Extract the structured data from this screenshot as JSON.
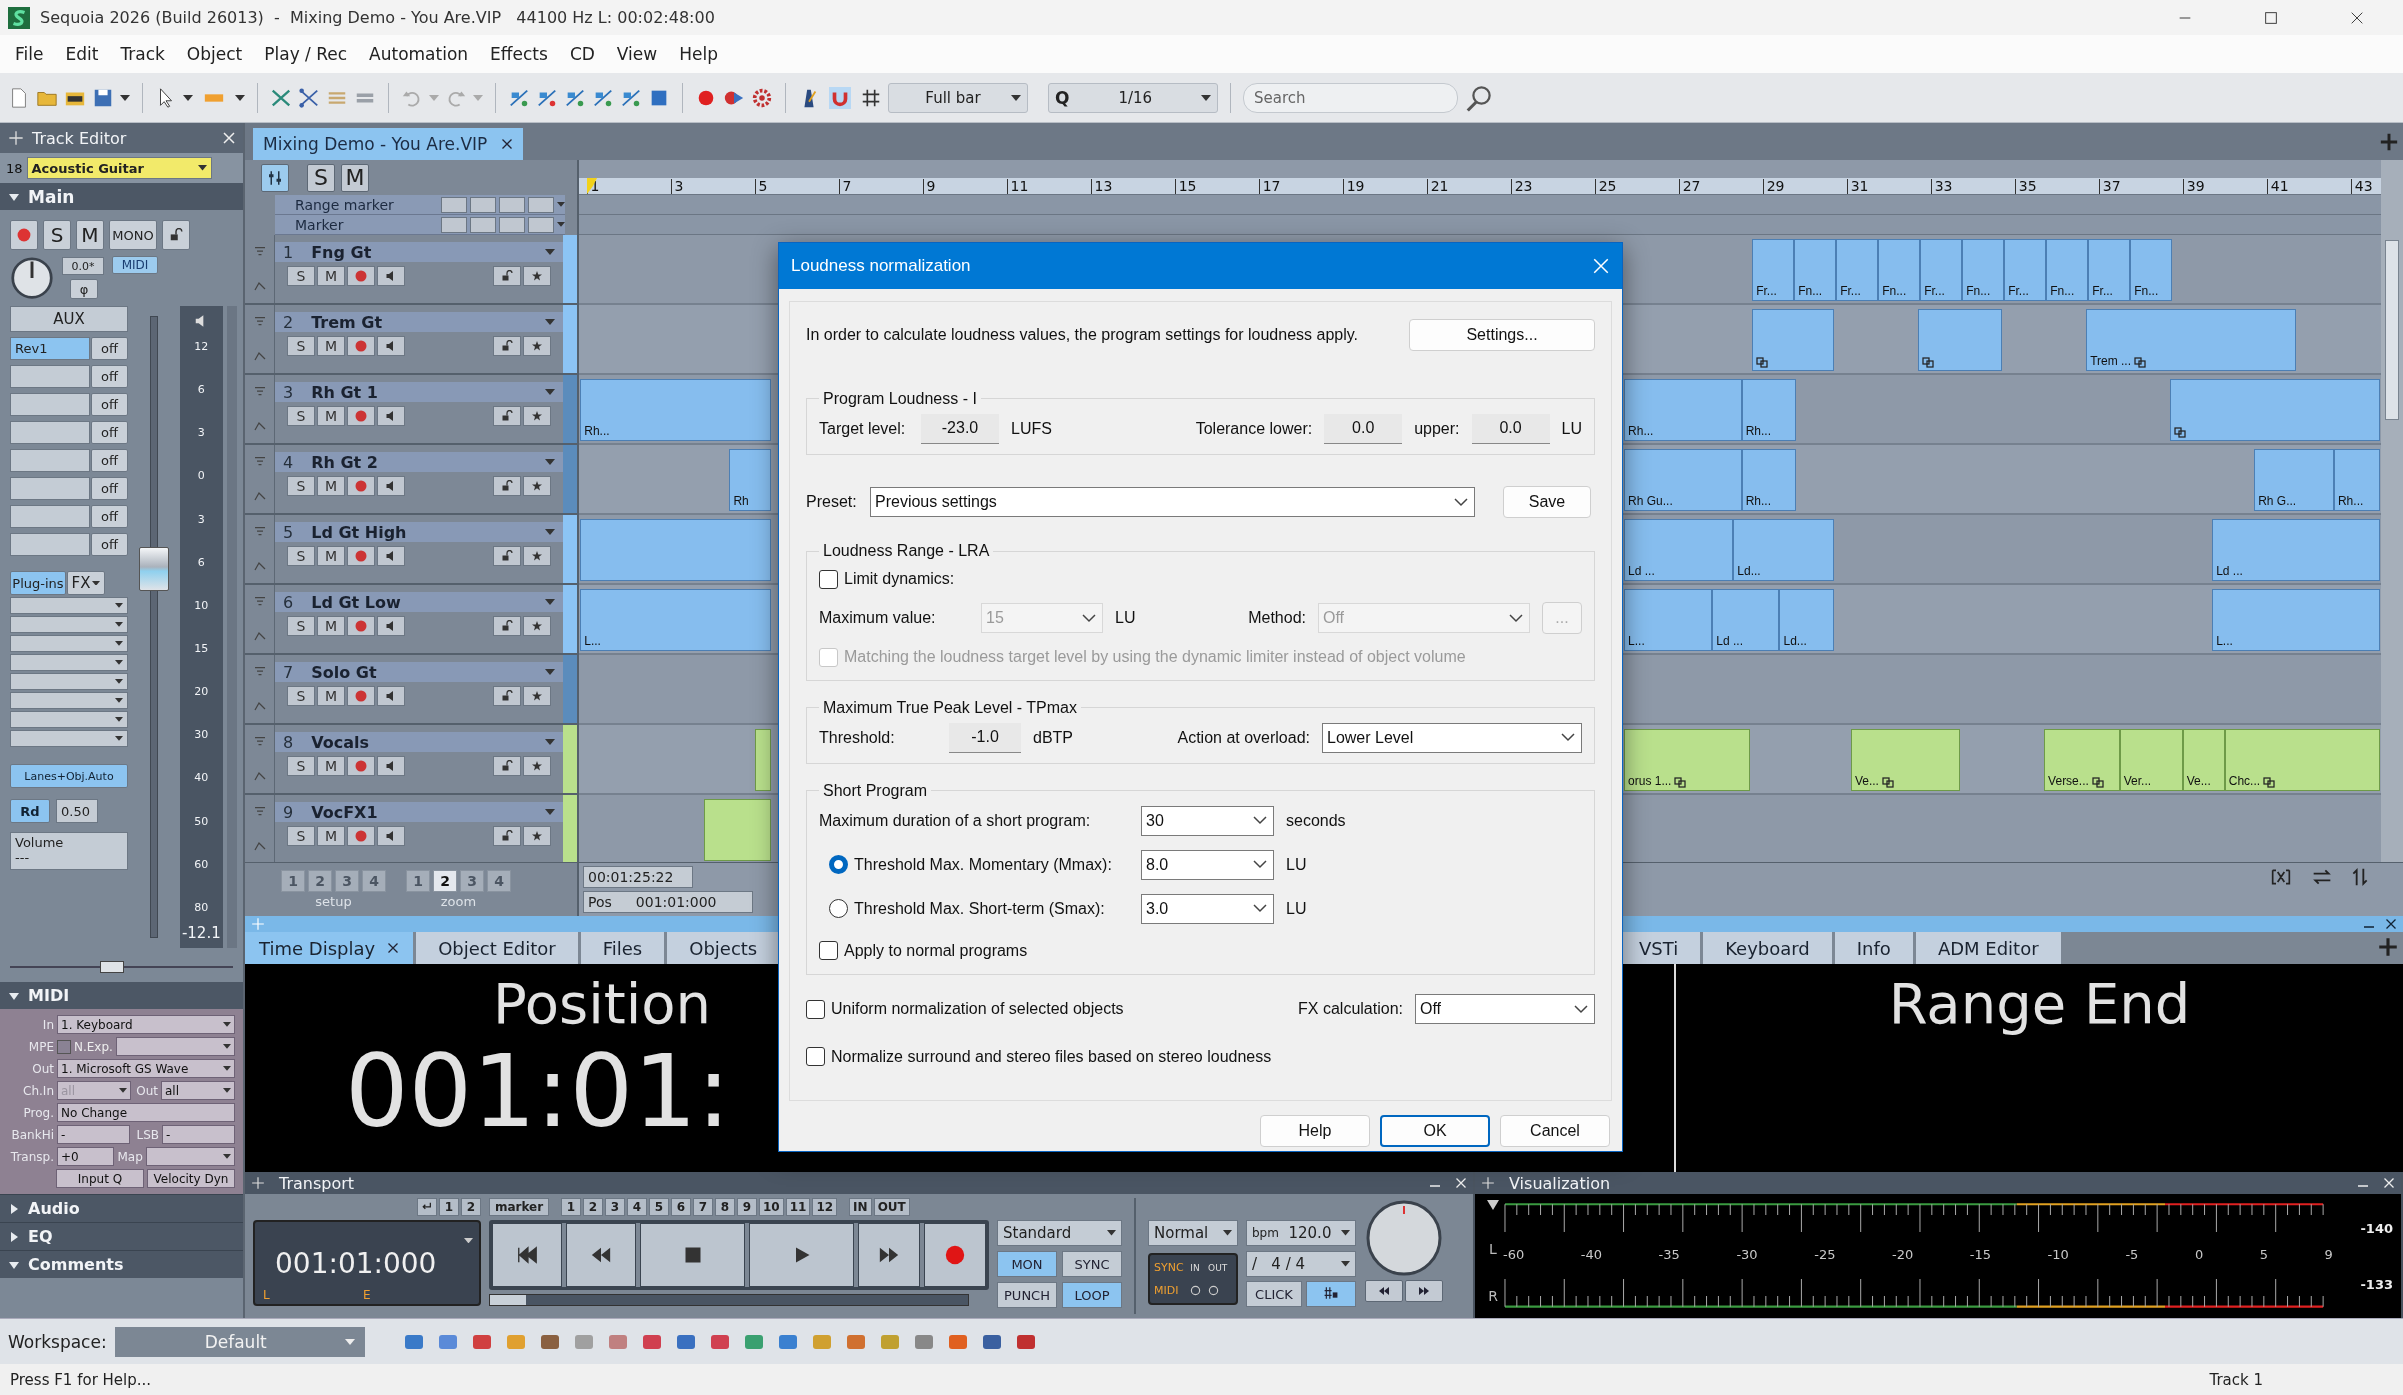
{
  "window": {
    "title": "Sequoia 2026 (Build 26013)  -  Mixing Demo - You Are.VIP   44100 Hz L: 00:02:48:00"
  },
  "menu": [
    "File",
    "Edit",
    "Track",
    "Object",
    "Play / Rec",
    "Automation",
    "Effects",
    "CD",
    "View",
    "Help"
  ],
  "toolbar": {
    "snap": "Full bar",
    "quantize_label": "Q",
    "quantize": "1/16",
    "search_placeholder": "Search"
  },
  "track_editor": {
    "title": "Track Editor",
    "number": "18",
    "name": "Acoustic Guitar",
    "main": {
      "title": "Main",
      "expanded": true
    },
    "solo": "S",
    "mute": "M",
    "mono": "MONO",
    "pan": "0.0*",
    "midi_badge": "MIDI",
    "phase": "φ",
    "aux": "AUX",
    "sends": [
      {
        "label": "Rev1",
        "value": "off"
      },
      {
        "value": "off"
      },
      {
        "value": "off"
      },
      {
        "value": "off"
      },
      {
        "value": "off"
      },
      {
        "value": "off"
      },
      {
        "value": "off"
      },
      {
        "value": "off"
      }
    ],
    "plugins": "Plug-ins",
    "fx": "FX",
    "lanes": "Lanes+Obj.Auto",
    "read_mode": "Rd",
    "auto_value": "0.50",
    "automation_label": "Volume",
    "automation_value": "---",
    "fader": {
      "level": 0.6
    },
    "balance": {
      "level": 0.45
    },
    "fader_scale": [
      "12",
      "6",
      "3",
      "0",
      "3",
      "6",
      "10",
      "15",
      "20",
      "30",
      "40",
      "50",
      "60",
      "80"
    ],
    "readout": "-12.1",
    "midi": {
      "title": "MIDI",
      "expanded": true,
      "in_label": "In",
      "in": "1. Keyboard",
      "mpe_label": "MPE",
      "mpe_checked": false,
      "n_exp": "N.Exp.",
      "out_label": "Out",
      "out": "1. Microsoft GS Wave",
      "ch_in_label": "Ch.In",
      "ch_in": "all",
      "ch_out_label": "Out",
      "ch_out": "all",
      "prog_label": "Prog.",
      "prog": "No Change",
      "bank_label": "BankHi",
      "bank": "-",
      "lsb_label": "LSB",
      "lsb": "-",
      "transp_label": "Transp.",
      "transp": "+0",
      "map_label": "Map",
      "input_q": "Input Q",
      "velocity": "Velocity Dyn"
    },
    "sections": [
      {
        "title": "Audio",
        "expanded": false
      },
      {
        "title": "EQ",
        "expanded": false
      },
      {
        "title": "Comments",
        "expanded": true
      }
    ]
  },
  "project_tab": {
    "title": "Mixing Demo - You Are.VIP"
  },
  "header": {
    "solo": "S",
    "mute": "M"
  },
  "markers": [
    {
      "label": "Range marker"
    },
    {
      "label": "Marker"
    }
  ],
  "ruler": [
    "1",
    "3",
    "5",
    "7",
    "9",
    "11",
    "13",
    "15",
    "17",
    "19",
    "21",
    "23",
    "25",
    "27",
    "29",
    "31",
    "33",
    "35",
    "37",
    "39",
    "41",
    "43"
  ],
  "tracks": [
    {
      "number": "1",
      "name": "Fng Gt",
      "color": "#8cc4f5",
      "solo": "S",
      "mute": "M",
      "clips": [
        {
          "label": "Fr...",
          "icon": false
        },
        {
          "label": "Fn...",
          "icon": false
        },
        {
          "label": "Fr...",
          "icon": false
        },
        {
          "label": "Fn...",
          "icon": false
        },
        {
          "label": "Fr...",
          "icon": false
        },
        {
          "label": "Fn...",
          "icon": false
        },
        {
          "label": "Fr...",
          "icon": false
        },
        {
          "label": "Fn...",
          "icon": false
        },
        {
          "label": "Fr...",
          "icon": false
        },
        {
          "label": "Fn...",
          "icon": false
        }
      ]
    },
    {
      "number": "2",
      "name": "Trem Gt",
      "color": "#8cc4f5",
      "solo": "S",
      "mute": "M",
      "clips": [
        {
          "icon": true
        },
        {
          "icon": true
        },
        {
          "label": "Trem ...",
          "icon": true
        }
      ]
    },
    {
      "number": "3",
      "name": "Rh Gt 1",
      "color": "#5b8cbc",
      "solo": "S",
      "mute": "M",
      "clips": [
        {
          "label": "Rh...",
          "icon": false
        },
        {
          "label": "Rh...",
          "icon": false
        },
        {
          "label": "Rh...",
          "icon": false
        },
        {
          "icon": true
        }
      ]
    },
    {
      "number": "4",
      "name": "Rh Gt 2",
      "color": "#5b8cbc",
      "solo": "S",
      "mute": "M",
      "clips": [
        {
          "label": "Rh",
          "icon": false
        },
        {
          "label": "Rh Gu...",
          "icon": false
        },
        {
          "label": "Rh...",
          "icon": false
        },
        {
          "label": "Rh G...",
          "icon": false
        },
        {
          "label": "Rh...",
          "icon": false
        }
      ]
    },
    {
      "number": "5",
      "name": "Ld Gt High",
      "color": "#8cc4f5",
      "solo": "S",
      "mute": "M",
      "clips": [
        {
          "icon": false
        },
        {
          "label": "Ld ...",
          "icon": false
        },
        {
          "label": "Ld...",
          "icon": false
        },
        {
          "label": "Ld ...",
          "icon": false
        }
      ]
    },
    {
      "number": "6",
      "name": "Ld Gt Low",
      "color": "#8cc4f5",
      "solo": "S",
      "mute": "M",
      "clips": [
        {
          "label": "L...",
          "icon": false
        },
        {
          "label": "L...",
          "icon": false
        },
        {
          "label": "Ld ...",
          "icon": false
        },
        {
          "label": "Ld...",
          "icon": false
        },
        {
          "label": "L...",
          "icon": false
        }
      ]
    },
    {
      "number": "7",
      "name": "Solo Gt",
      "color": "#5b8cbc",
      "solo": "S",
      "mute": "M"
    },
    {
      "number": "8",
      "name": "Vocals",
      "color": "#b9e08c",
      "solo": "S",
      "mute": "M",
      "clips": [
        {
          "icon": false
        },
        {
          "label": "orus 1...",
          "icon": true
        },
        {
          "label": "Ve...",
          "icon": true
        },
        {
          "label": "Verse...",
          "icon": true
        },
        {
          "label": "Ver...",
          "icon": false
        },
        {
          "label": "Ve...",
          "icon": false
        },
        {
          "label": "Chc...",
          "icon": true
        }
      ]
    },
    {
      "number": "9",
      "name": "VocFX1",
      "color": "#b9e08c",
      "solo": "S",
      "mute": "M",
      "clips": [
        {
          "icon": false
        }
      ]
    }
  ],
  "setup": {
    "label": "setup",
    "buttons": [
      {
        "label": "1",
        "selected": false
      },
      {
        "label": "2",
        "selected": false
      },
      {
        "label": "3",
        "selected": false
      },
      {
        "label": "4",
        "selected": false
      }
    ]
  },
  "zoom": {
    "label": "zoom",
    "buttons": [
      {
        "label": "1",
        "selected": false
      },
      {
        "label": "2",
        "selected": true
      },
      {
        "label": "3",
        "selected": false
      },
      {
        "label": "4",
        "selected": false
      }
    ]
  },
  "position": {
    "time": "00:01:25:22",
    "pos_label": "Pos",
    "pos": "001:01:000"
  },
  "dock": {
    "tabs": [
      {
        "label": "Time Display",
        "selected": true
      },
      {
        "label": "Object Editor",
        "selected": false
      },
      {
        "label": "Files",
        "selected": false
      },
      {
        "label": "Objects",
        "selected": false
      },
      {
        "label": "VSTi",
        "selected": false
      },
      {
        "label": "Keyboard",
        "selected": false
      },
      {
        "label": "Info",
        "selected": false
      },
      {
        "label": "ADM Editor",
        "selected": false
      }
    ],
    "position_title": "Position",
    "position_value": "001:01:",
    "range_title": "Range End"
  },
  "transport": {
    "title": "Transport",
    "undo_marks": [
      "1",
      "2"
    ],
    "marker": "marker",
    "markers": [
      "1",
      "2",
      "3",
      "4",
      "5",
      "6",
      "7",
      "8",
      "9",
      "10",
      "11",
      "12"
    ],
    "in": "IN",
    "out": "OUT",
    "time": "001:01:000",
    "left": "L",
    "end": "E",
    "mode": "Standard",
    "switches": [
      {
        "label": "MON",
        "on": true
      },
      {
        "label": "SYNC",
        "on": false
      },
      {
        "label": "PUNCH",
        "on": false
      },
      {
        "label": "LOOP",
        "on": true
      }
    ],
    "speed": "Normal",
    "bpm_label": "bpm",
    "bpm": "120.0",
    "signature": "/   4 / 4",
    "sync": "SYNC",
    "midi": "MIDI",
    "port_in": "IN",
    "port_out": "OUT",
    "click": "CLICK"
  },
  "visualization": {
    "title": "Visualization",
    "channels": [
      "L",
      "R"
    ],
    "scale": [
      "-60",
      "-40",
      "-35",
      "-30",
      "-25",
      "-20",
      "-15",
      "-10",
      "-5",
      "0",
      "5",
      "9"
    ],
    "peaks": [
      "-140",
      "-133"
    ]
  },
  "workspace": {
    "label": "Workspace:",
    "value": "Default"
  },
  "status": {
    "left": "Press F1 for Help...",
    "right": "Track 1"
  },
  "dialog": {
    "title": "Loudness normalization",
    "intro": "In order to calculate loudness values, the program settings for loudness apply.",
    "settings_button": "Settings...",
    "program": {
      "title": "Program Loudness - I",
      "target_label": "Target level:",
      "target": "-23.0",
      "target_unit": "LUFS",
      "tol_lower_label": "Tolerance lower:",
      "tol_lower": "0.0",
      "tol_upper_label": "upper:",
      "tol_upper": "0.0",
      "tol_unit": "LU"
    },
    "preset": {
      "label": "Preset:",
      "value": "Previous settings",
      "save": "Save"
    },
    "lra": {
      "title": "Loudness Range - LRA",
      "limit": {
        "label": "Limit dynamics:",
        "checked": false
      },
      "disabled": true,
      "max_label": "Maximum value:",
      "max": "15",
      "max_unit": "LU",
      "method_label": "Method:",
      "method": "Off",
      "more": "...",
      "matching": {
        "label": "Matching the loudness target level by using the dynamic limiter instead of object volume",
        "checked": false
      }
    },
    "tp": {
      "title": "Maximum True Peak Level - TPmax",
      "threshold_label": "Threshold:",
      "threshold": "-1.0",
      "unit": "dBTP",
      "action_label": "Action at overload:",
      "action": "Lower Level"
    },
    "short": {
      "title": "Short Program",
      "duration_label": "Maximum duration of a short program:",
      "duration": "30",
      "duration_unit": "seconds",
      "options": [
        {
          "label": "Threshold Max. Momentary (Mmax):",
          "selected": true,
          "value": "8.0",
          "unit": "LU"
        },
        {
          "label": "Threshold Max. Short-term (Smax):",
          "selected": false,
          "value": "3.0",
          "unit": "LU"
        }
      ],
      "apply": {
        "label": "Apply to normal programs",
        "checked": false
      }
    },
    "uniform": {
      "label": "Uniform normalization of selected objects",
      "checked": false
    },
    "fx_label": "FX calculation:",
    "fx": "Off",
    "surround": {
      "label": "Normalize surround and stereo files based on stereo loudness",
      "checked": false
    },
    "buttons": [
      {
        "label": "Help",
        "default": false
      },
      {
        "label": "OK",
        "default": true
      },
      {
        "label": "Cancel",
        "default": false
      }
    ]
  }
}
